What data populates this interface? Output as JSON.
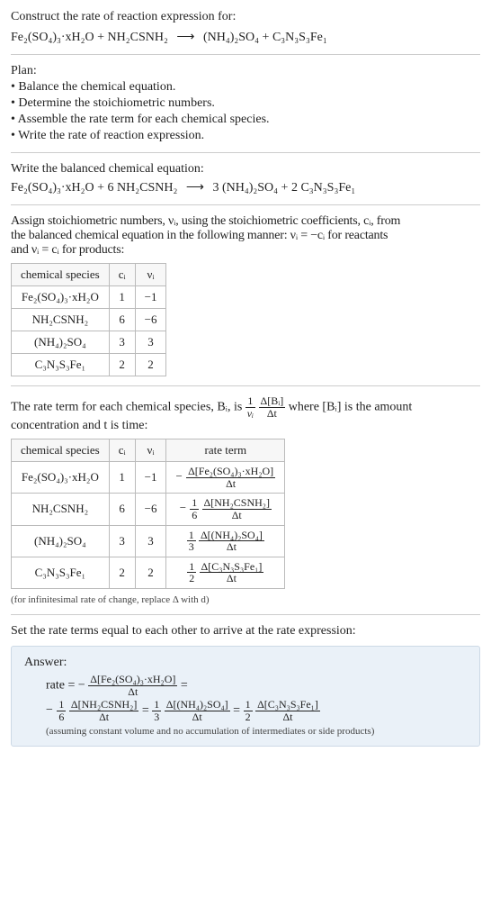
{
  "title": "Construct the rate of reaction expression for:",
  "unbalanced_eq": {
    "lhs1": "Fe₂(SO₄)₃·xH₂O",
    "plus1": " + ",
    "lhs2": "NH₂CSNH₂",
    "arrow": "⟶",
    "rhs1": "(NH₄)₂SO₄",
    "plus2": " + ",
    "rhs2": "C₃N₃S₃Fe₁"
  },
  "plan": {
    "heading": "Plan:",
    "items": [
      "Balance the chemical equation.",
      "Determine the stoichiometric numbers.",
      "Assemble the rate term for each chemical species.",
      "Write the rate of reaction expression."
    ]
  },
  "balanced_heading": "Write the balanced chemical equation:",
  "balanced_eq": {
    "lhs1": "Fe₂(SO₄)₃·xH₂O",
    "plus1": " + 6 ",
    "lhs2": "NH₂CSNH₂",
    "arrow": "⟶",
    "rhs_pre1": "3 ",
    "rhs1": "(NH₄)₂SO₄",
    "plus2": " + 2 ",
    "rhs2": "C₃N₃S₃Fe₁"
  },
  "assign_text_1": "Assign stoichiometric numbers, νᵢ, using the stoichiometric coefficients, cᵢ, from",
  "assign_text_2": "the balanced chemical equation in the following manner: νᵢ = −cᵢ for reactants",
  "assign_text_3": "and νᵢ = cᵢ for products:",
  "table1": {
    "headers": [
      "chemical species",
      "cᵢ",
      "νᵢ"
    ],
    "rows": [
      [
        "Fe₂(SO₄)₃·xH₂O",
        "1",
        "−1"
      ],
      [
        "NH₂CSNH₂",
        "6",
        "−6"
      ],
      [
        "(NH₄)₂SO₄",
        "3",
        "3"
      ],
      [
        "C₃N₃S₃Fe₁",
        "2",
        "2"
      ]
    ]
  },
  "rate_term_text_1a": "The rate term for each chemical species, Bᵢ, is ",
  "rate_term_frac1": {
    "num": "1",
    "den": "νᵢ"
  },
  "rate_term_frac2": {
    "num": "Δ[Bᵢ]",
    "den": "Δt"
  },
  "rate_term_text_1b": " where [Bᵢ] is the amount",
  "rate_term_text_2": "concentration and t is time:",
  "table2": {
    "headers": [
      "chemical species",
      "cᵢ",
      "νᵢ",
      "rate term"
    ],
    "rows": [
      {
        "sp": "Fe₂(SO₄)₃·xH₂O",
        "ci": "1",
        "vi": "−1",
        "neg": "−",
        "coef_num": "",
        "coef_den": "",
        "num": "Δ[Fe₂(SO₄)₃·xH₂O]",
        "den": "Δt"
      },
      {
        "sp": "NH₂CSNH₂",
        "ci": "6",
        "vi": "−6",
        "neg": "−",
        "coef_num": "1",
        "coef_den": "6",
        "num": "Δ[NH₂CSNH₂]",
        "den": "Δt"
      },
      {
        "sp": "(NH₄)₂SO₄",
        "ci": "3",
        "vi": "3",
        "neg": "",
        "coef_num": "1",
        "coef_den": "3",
        "num": "Δ[(NH₄)₂SO₄]",
        "den": "Δt"
      },
      {
        "sp": "C₃N₃S₃Fe₁",
        "ci": "2",
        "vi": "2",
        "neg": "",
        "coef_num": "1",
        "coef_den": "2",
        "num": "Δ[C₃N₃S₃Fe₁]",
        "den": "Δt"
      }
    ]
  },
  "inf_note": "(for infinitesimal rate of change, replace Δ with d)",
  "set_equal_text": "Set the rate terms equal to each other to arrive at the rate expression:",
  "answer": {
    "label": "Answer:",
    "line1_pre": "rate = −",
    "line1_frac": {
      "num": "Δ[Fe₂(SO₄)₃·xH₂O]",
      "den": "Δt"
    },
    "line1_post": " = ",
    "line2_pre": "−",
    "l2_c1": {
      "num": "1",
      "den": "6"
    },
    "l2_f1": {
      "num": "Δ[NH₂CSNH₂]",
      "den": "Δt"
    },
    "eq1": " = ",
    "l2_c2": {
      "num": "1",
      "den": "3"
    },
    "l2_f2": {
      "num": "Δ[(NH₄)₂SO₄]",
      "den": "Δt"
    },
    "eq2": " = ",
    "l2_c3": {
      "num": "1",
      "den": "2"
    },
    "l2_f3": {
      "num": "Δ[C₃N₃S₃Fe₁]",
      "den": "Δt"
    },
    "note": "(assuming constant volume and no accumulation of intermediates or side products)"
  }
}
